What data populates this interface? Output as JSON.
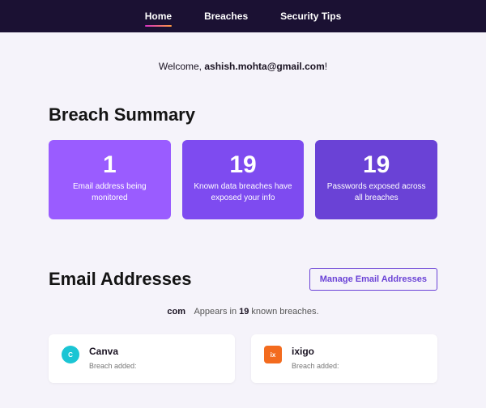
{
  "nav": {
    "items": [
      "Home",
      "Breaches",
      "Security Tips"
    ],
    "activeIndex": 0
  },
  "welcome": {
    "prefix": "Welcome, ",
    "email": "ashish.mohta@gmail.com",
    "suffix": "!"
  },
  "summary": {
    "title": "Breach Summary",
    "cards": [
      {
        "value": "1",
        "label": "Email address being monitored"
      },
      {
        "value": "19",
        "label": "Known data breaches have exposed your info"
      },
      {
        "value": "19",
        "label": "Passwords exposed across all breaches"
      }
    ]
  },
  "emails": {
    "title": "Email Addresses",
    "manage_label": "Manage Email Addresses",
    "appears": {
      "domain": "com",
      "prefix": "Appears in ",
      "count": "19",
      "suffix": " known breaches."
    },
    "breaches": [
      {
        "name": "Canva",
        "sub": "Breach added:",
        "logo": "canva",
        "glyph": "C"
      },
      {
        "name": "ixigo",
        "sub": "Breach added:",
        "logo": "ixigo",
        "glyph": "ix"
      }
    ]
  }
}
